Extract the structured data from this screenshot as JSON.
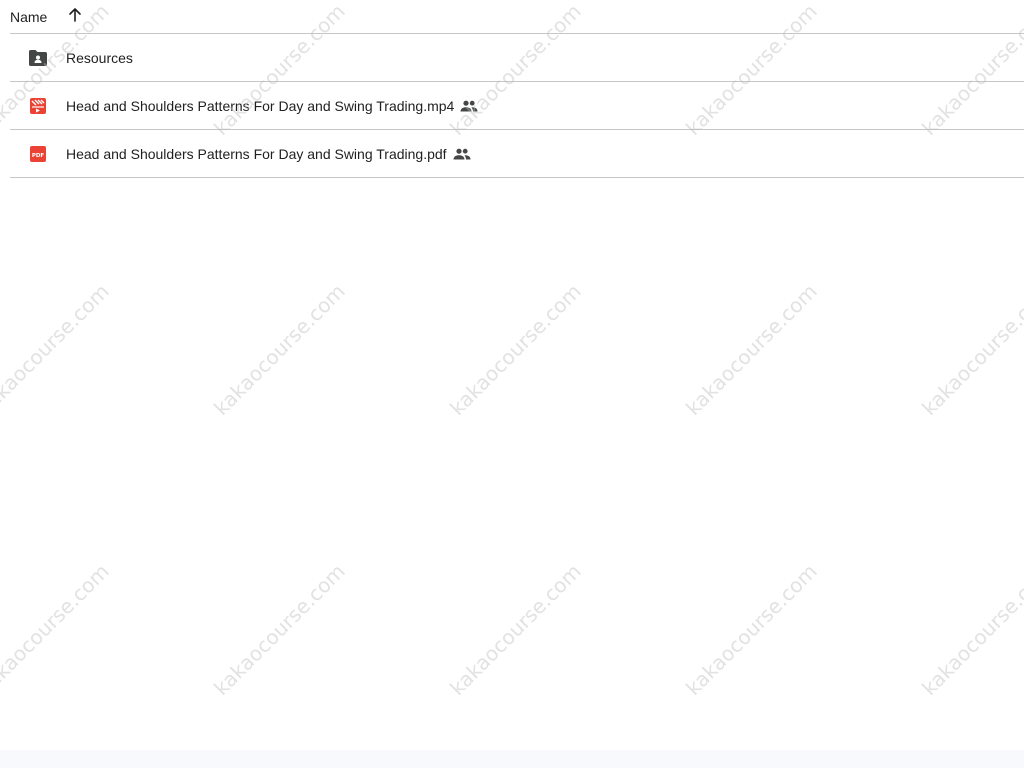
{
  "header": {
    "name_label": "Name",
    "sort_icon": "arrow-up-icon"
  },
  "files": [
    {
      "name": "Resources",
      "type": "shared-folder",
      "icon": "shared-folder-icon",
      "icon_color": "#444746",
      "shared": false
    },
    {
      "name": "Head and Shoulders Patterns For Day and Swing Trading.mp4",
      "type": "video",
      "icon": "video-file-icon",
      "icon_color": "#ea4335",
      "shared": true
    },
    {
      "name": "Head and Shoulders Patterns For Day and Swing Trading.pdf",
      "type": "pdf",
      "icon": "pdf-file-icon",
      "icon_color": "#ea4335",
      "shared": true
    }
  ],
  "shared_icon": "people-icon",
  "watermark": "kakaocourse.com"
}
